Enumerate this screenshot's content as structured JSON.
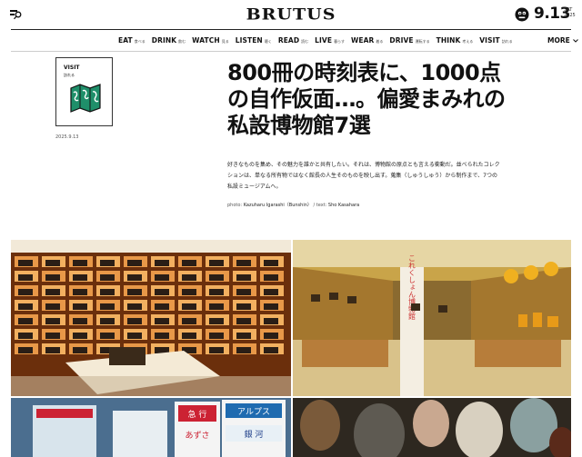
{
  "header": {
    "logo": "BRUTUS",
    "date_big": "9.13",
    "date_day": "SAT",
    "date_year": "2025"
  },
  "nav": {
    "items": [
      {
        "en": "EAT",
        "jp": "食べる"
      },
      {
        "en": "DRINK",
        "jp": "飲む"
      },
      {
        "en": "WATCH",
        "jp": "見る"
      },
      {
        "en": "LISTEN",
        "jp": "聴く"
      },
      {
        "en": "READ",
        "jp": "読む"
      },
      {
        "en": "LIVE",
        "jp": "暮らす"
      },
      {
        "en": "WEAR",
        "jp": "着る"
      },
      {
        "en": "DRIVE",
        "jp": "運転する"
      },
      {
        "en": "THINK",
        "jp": "考える"
      },
      {
        "en": "VISIT",
        "jp": "訪れる"
      }
    ],
    "more": "MORE"
  },
  "article": {
    "category_en": "VISIT",
    "category_jp": "訪れる",
    "date": "2025.9.13",
    "title_lines": [
      "800冊の時刻表に、1000点",
      "の自作仮面…。偏愛まみれの",
      "私設博物館7選"
    ],
    "lead_lines": [
      "好きなものを集め、その魅力を誰かと共有したい。それは、博物館の原点とも言える衝動だ。並べられたコレク",
      "ションは、単なる所有物ではなく館長の人生そのものを映し出す。蒐集（しゅうしゅう）から制作まで、7つの",
      "私設ミュージアムへ。"
    ],
    "credit_photo_label": "photo:",
    "credit_photo": "Kazuharu Igarashi（Bunshin）",
    "credit_sep": "/ text:",
    "credit_text": "Sho Kasahara"
  },
  "photos": {
    "sign_text": "これくしょん博物館",
    "board1_top": "急 行",
    "board1_bottom": "あずさ",
    "board2_top": "アルプス",
    "board2_bottom": "銀 河"
  },
  "colors": {
    "icon_green": "#1f8f6a",
    "rule": "#222222"
  }
}
